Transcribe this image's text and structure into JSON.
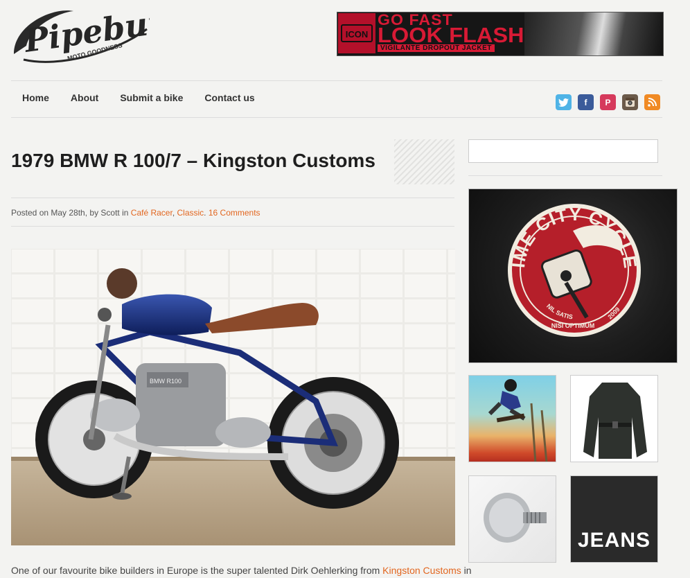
{
  "header": {
    "logo_text": "Pipeburn",
    "logo_tagline": "MOTO GOODNESS",
    "banner": {
      "badge": "ICON",
      "line1": "GO FAST",
      "line2": "LOOK FLASH",
      "line3": "VIGILANTE DROPOUT JACKET"
    }
  },
  "nav": {
    "items": [
      {
        "label": "Home"
      },
      {
        "label": "About"
      },
      {
        "label": "Submit a bike"
      },
      {
        "label": "Contact us"
      }
    ]
  },
  "social": {
    "icons": [
      "twitter-icon",
      "facebook-icon",
      "pinterest-icon",
      "instagram-icon",
      "rss-icon"
    ],
    "colors": {
      "twitter": "#4fb3e6",
      "facebook": "#3b5b9a",
      "pinterest": "#d63a5c",
      "instagram": "#6b5a4a",
      "rss": "#f08a24"
    }
  },
  "post": {
    "title": "1979 BMW R 100/7 – Kingston Customs",
    "meta_prefix": "Posted on May 28th, by Scott in",
    "category1": "Café Racer",
    "sep": ",",
    "category2": "Classic",
    "dot": ".",
    "comments": "16 Comments",
    "body_prefix": "One of our favourite bike builders in Europe is the super talented Dirk Oehlerking from",
    "body_link": "Kingston Customs",
    "body_suffix": "in",
    "hero_plate": "BMW R100"
  },
  "sidebar": {
    "search_placeholder": "",
    "ad": {
      "brand_top": "DIME CITY CYCLES",
      "motto1": "NIL SATIS",
      "motto2": "NISI OPTIMUM",
      "year": "2009"
    },
    "thumb_jeans": "JEANS"
  },
  "accent_color": "#e2661f"
}
